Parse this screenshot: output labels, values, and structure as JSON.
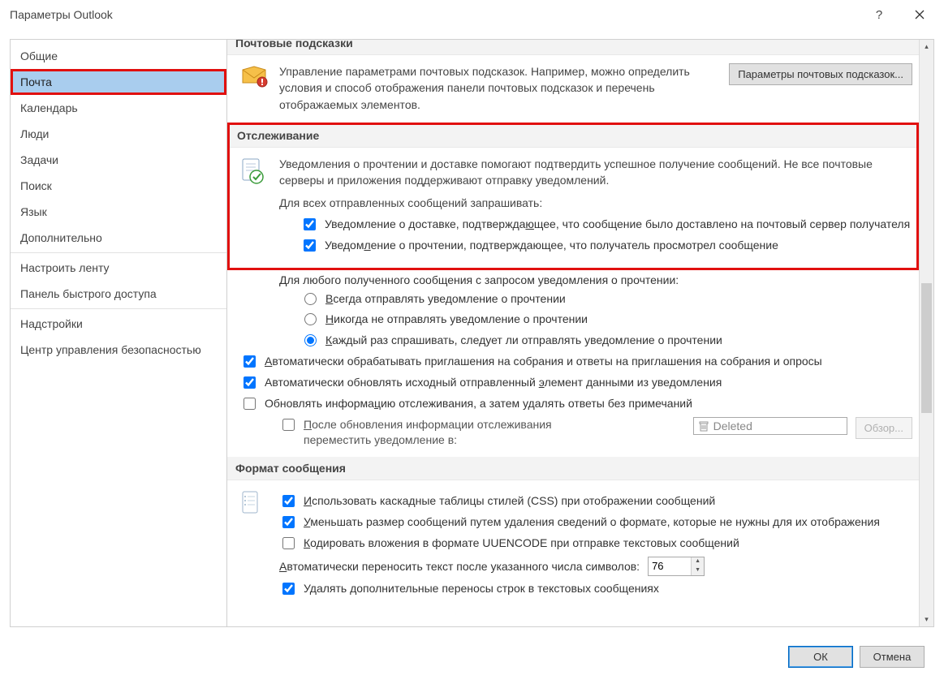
{
  "window": {
    "title": "Параметры Outlook"
  },
  "sidebar": {
    "items": [
      {
        "key": "general",
        "label": "Общие"
      },
      {
        "key": "mail",
        "label": "Почта"
      },
      {
        "key": "calendar",
        "label": "Календарь"
      },
      {
        "key": "people",
        "label": "Люди"
      },
      {
        "key": "tasks",
        "label": "Задачи"
      },
      {
        "key": "search",
        "label": "Поиск"
      },
      {
        "key": "language",
        "label": "Язык"
      },
      {
        "key": "advanced",
        "label": "Дополнительно"
      },
      {
        "key": "ribbon",
        "label": "Настроить ленту"
      },
      {
        "key": "qat",
        "label": "Панель быстрого доступа"
      },
      {
        "key": "addins",
        "label": "Надстройки"
      },
      {
        "key": "trust",
        "label": "Центр управления безопасностью"
      }
    ],
    "selected": "mail"
  },
  "sections": {
    "mail_tips": {
      "header": "Почтовые подсказки",
      "desc": "Управление параметрами почтовых подсказок. Например, можно определить условия и способ отображения панели почтовых подсказок и перечень отображаемых элементов.",
      "button": "Параметры почтовых подсказок..."
    },
    "tracking": {
      "header": "Отслеживание",
      "desc": "Уведомления о прочтении и доставке помогают подтвердить успешное получение сообщений. Не все почтовые серверы и приложения поддерживают отправку уведомлений.",
      "request_label": "Для всех отправленных сообщений запрашивать:",
      "chk_delivery": "Уведомление о доставке, подтверждающее, что сообщение было доставлено на почтовый сервер получателя",
      "chk_read": "Уведомление о прочтении, подтверждающее, что получатель просмотрел сообщение",
      "for_any_received": "Для любого полученного сообщения с запросом уведомления о прочтении:",
      "radio_always": "Всегда отправлять уведомление о прочтении",
      "radio_never": "Никогда не отправлять уведомление о прочтении",
      "radio_ask": "Каждый раз спрашивать, следует ли отправлять уведомление о прочтении",
      "chk_auto_process": "Автоматически обрабатывать приглашения на собрания и ответы на приглашения на собрания и опросы",
      "chk_auto_update": "Автоматически обновлять исходный отправленный элемент данными из уведомления",
      "chk_update_then_delete": "Обновлять информацию отслеживания, а затем удалять ответы без примечаний",
      "chk_after_update_move": "После обновления информации отслеживания переместить уведомление в:",
      "deleted_field": "Deleted",
      "browse_btn": "Обзор..."
    },
    "message_format": {
      "header": "Формат сообщения",
      "chk_css": "Использовать каскадные таблицы стилей (CSS) при отображении сообщений",
      "chk_shrink": "Уменьшать размер сообщений путем удаления сведений о формате, которые не нужны для их отображения",
      "chk_uuencode": "Кодировать вложения в формате UUENCODE при отправке текстовых сообщений",
      "wrap_label": "Автоматически переносить текст после указанного числа символов:",
      "wrap_value": "76",
      "chk_remove_extra": "Удалять дополнительные переносы строк в текстовых сообщениях"
    }
  },
  "footer": {
    "ok": "ОК",
    "cancel": "Отмена"
  }
}
